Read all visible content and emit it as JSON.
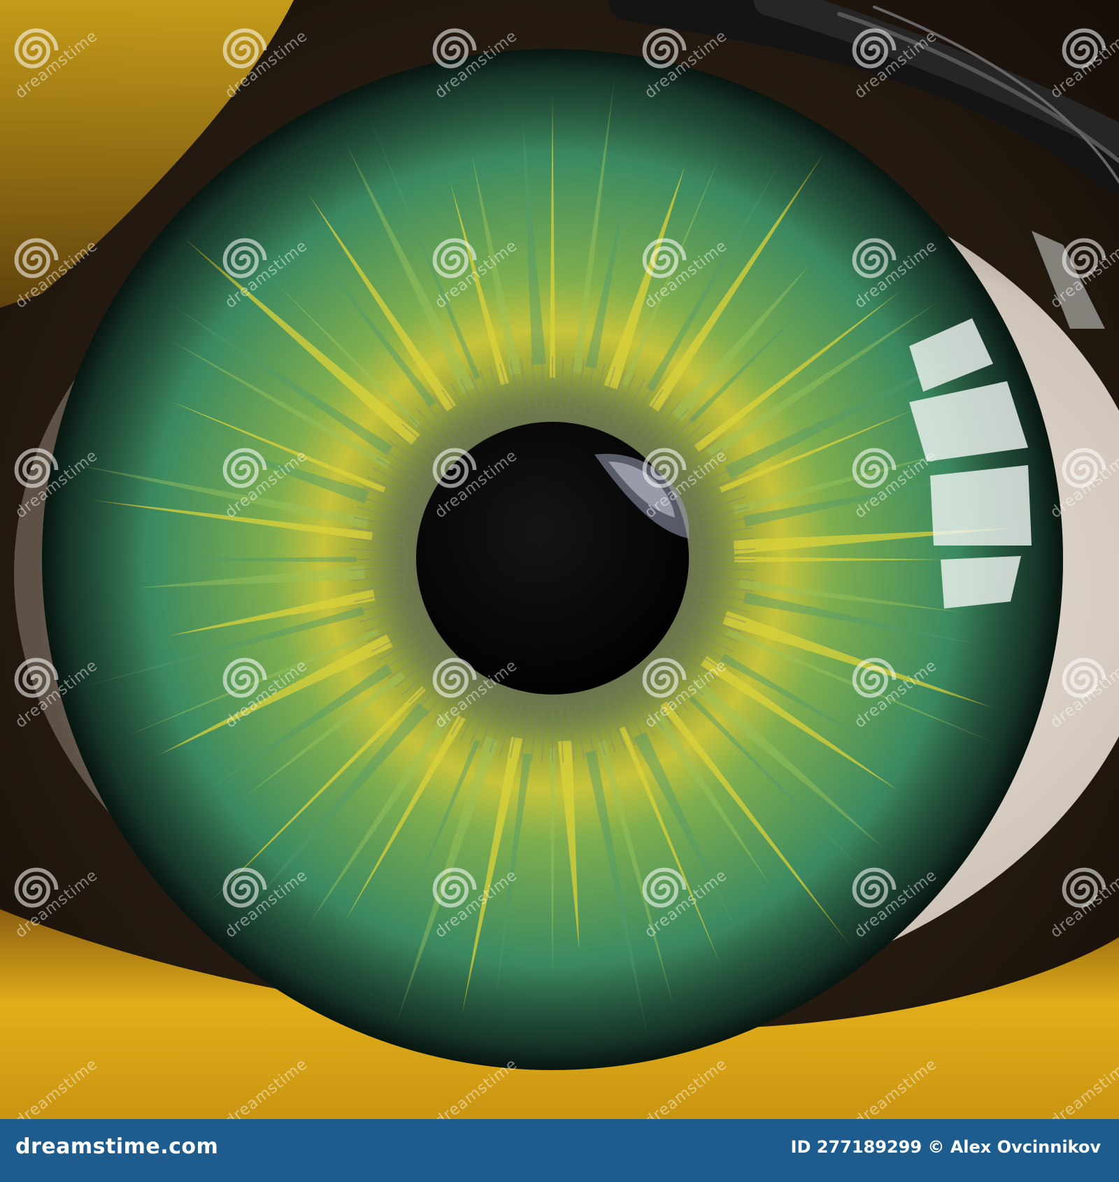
{
  "photo": {
    "subject": "macro-green-iris",
    "colors": {
      "iris_outer": "#2f7a5a",
      "iris_mid": "#6fa34a",
      "iris_fiber_yellow": "#d9d23a",
      "pupil": "#050505",
      "eyelid_yellow": "#e0b21a",
      "lashes": "#141414",
      "sclera": "#e8e2dc"
    }
  },
  "watermark": {
    "text": "dreamstime",
    "icon": "spiral-logo-icon"
  },
  "footer": {
    "brand": "dreamstime.com",
    "credit": "ID 277189299 © Alex Ovcinnikov",
    "background": "#1d5c8c"
  }
}
